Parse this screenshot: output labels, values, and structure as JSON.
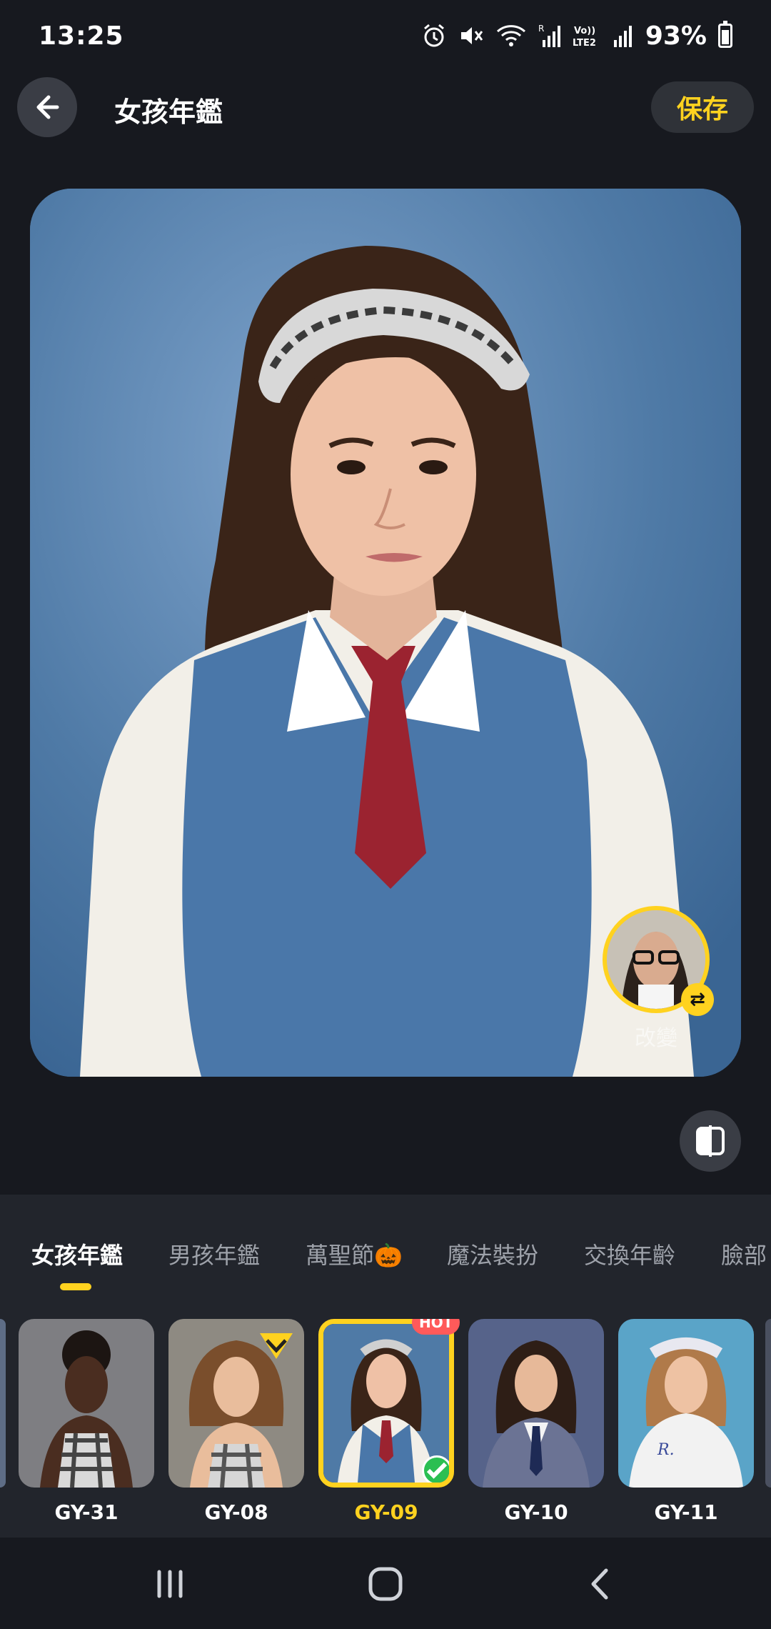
{
  "status_bar": {
    "time": "13:25",
    "battery": "93%",
    "icons": [
      "alarm-icon",
      "mute-icon",
      "wifi-icon",
      "signal-r-icon",
      "volte-icon",
      "signal-icon",
      "battery-icon"
    ],
    "volte_label": "Vo)) LTE2"
  },
  "header": {
    "title": "女孩年鑑",
    "save_label": "保存",
    "accent_color": "#ffd21f"
  },
  "preview": {
    "face_swap_label": "改變"
  },
  "tabs": [
    {
      "label": "女孩年鑑",
      "active": true
    },
    {
      "label": "男孩年鑑",
      "active": false
    },
    {
      "label": "萬聖節🎃",
      "active": false
    },
    {
      "label": "魔法裝扮",
      "active": false
    },
    {
      "label": "交換年齡",
      "active": false
    },
    {
      "label": "臉部",
      "active": false
    }
  ],
  "styles": [
    {
      "id": "GY-31",
      "selected": false,
      "badge": ""
    },
    {
      "id": "GY-08",
      "selected": false,
      "badge": "vip"
    },
    {
      "id": "GY-09",
      "selected": true,
      "badge": "HOT"
    },
    {
      "id": "GY-10",
      "selected": false,
      "badge": ""
    },
    {
      "id": "GY-11",
      "selected": false,
      "badge": ""
    }
  ]
}
